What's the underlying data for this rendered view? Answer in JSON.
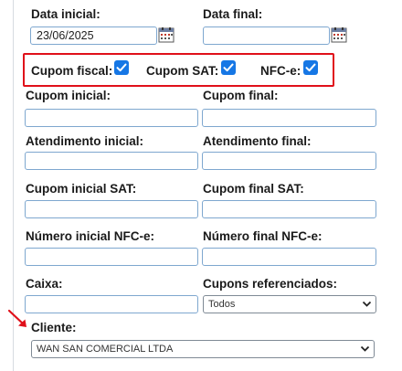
{
  "fields": {
    "data_inicial": {
      "label": "Data inicial:",
      "value": "23/06/2025"
    },
    "data_final": {
      "label": "Data final:",
      "value": ""
    },
    "cupom_inicial": {
      "label": "Cupom inicial:",
      "value": ""
    },
    "cupom_final": {
      "label": "Cupom final:",
      "value": ""
    },
    "atendimento_inicial": {
      "label": "Atendimento inicial:",
      "value": ""
    },
    "atendimento_final": {
      "label": "Atendimento final:",
      "value": ""
    },
    "cupom_inicial_sat": {
      "label": "Cupom inicial SAT:",
      "value": ""
    },
    "cupom_final_sat": {
      "label": "Cupom final SAT:",
      "value": ""
    },
    "numero_inicial_nfce": {
      "label": "Número inicial NFC-e:",
      "value": ""
    },
    "numero_final_nfce": {
      "label": "Número final NFC-e:",
      "value": ""
    },
    "caixa": {
      "label": "Caixa:",
      "value": ""
    }
  },
  "checkboxes": {
    "cupom_fiscal": {
      "label": "Cupom fiscal:",
      "checked": true
    },
    "cupom_sat": {
      "label": "Cupom SAT:",
      "checked": true
    },
    "nfce": {
      "label": "NFC-e:",
      "checked": true
    }
  },
  "selects": {
    "cupons_referenciados": {
      "label": "Cupons referenciados:",
      "selected": "Todos"
    },
    "cliente": {
      "label": "Cliente:",
      "selected": "WAN SAN COMERCIAL LTDA"
    }
  },
  "colors": {
    "highlight_border": "#e0101a",
    "checkbox_fill": "#1677e5",
    "input_border": "#7ea7cf",
    "annotation_arrow": "#e0101a"
  },
  "icons": {
    "calendar": "calendar-icon",
    "checkmark": "checkmark-icon",
    "dropdown": "chevron-down-icon",
    "annotation": "red-arrow-icon"
  }
}
